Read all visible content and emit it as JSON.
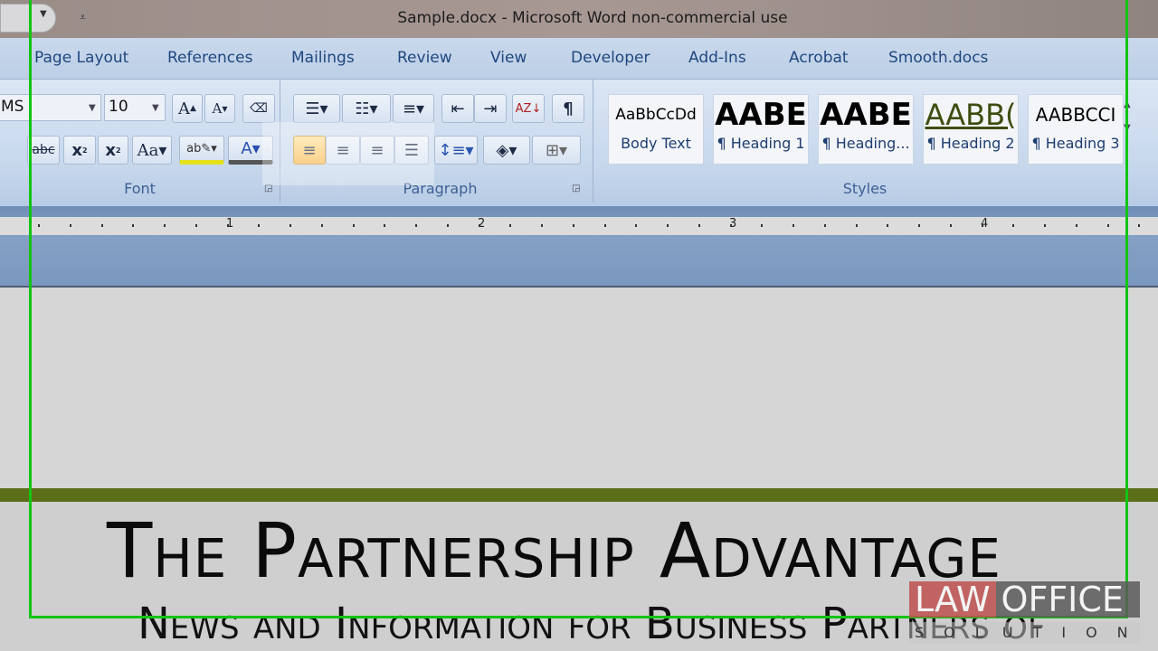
{
  "window": {
    "title": "Sample.docx - Microsoft Word non-commercial use"
  },
  "tabs": [
    "Page Layout",
    "References",
    "Mailings",
    "Review",
    "View",
    "Developer",
    "Add-Ins",
    "Acrobat",
    "Smooth.docs"
  ],
  "font": {
    "name": "MS",
    "size": "10",
    "group_label": "Font"
  },
  "paragraph": {
    "group_label": "Paragraph",
    "active_alignment": "align-left"
  },
  "styles": {
    "group_label": "Styles",
    "items": [
      {
        "preview": "AaBbCcDd",
        "name": "Body Text"
      },
      {
        "preview": "AABE",
        "name": "¶ Heading 1"
      },
      {
        "preview": "AABE",
        "name": "¶ Heading..."
      },
      {
        "preview": "AABB(",
        "name": "¶ Heading 2"
      },
      {
        "preview": "AABBCCI",
        "name": "¶ Heading 3"
      }
    ]
  },
  "ruler": [
    "1",
    "2",
    "3",
    "4"
  ],
  "document": {
    "title": "The Partnership Advantage",
    "subtitle": "News and Information for Business Partners of",
    "accent_color": "#5b6f18"
  },
  "watermark": {
    "line1a": "LAW",
    "line1b": "OFFICE",
    "line2": "SOLUTION"
  }
}
